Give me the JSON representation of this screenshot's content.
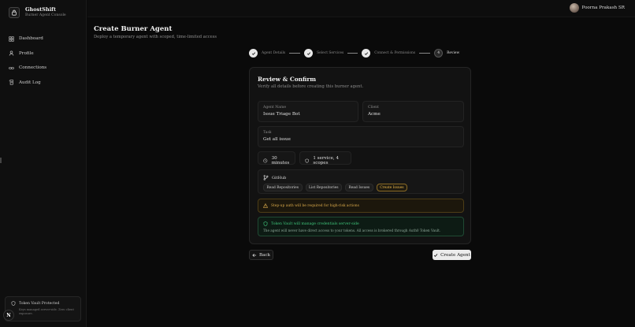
{
  "brand": {
    "name": "GhostShift",
    "subtitle": "Burner Agent Console"
  },
  "sidebar": {
    "items": [
      {
        "label": "Dashboard",
        "icon": "grid-icon"
      },
      {
        "label": "Profile",
        "icon": "user-icon"
      },
      {
        "label": "Connections",
        "icon": "link-icon"
      },
      {
        "label": "Audit Log",
        "icon": "scroll-icon"
      }
    ],
    "vault": {
      "title": "Token Vault Protected",
      "description": "Keys managed server-side. Zero client exposure."
    },
    "badge": "N"
  },
  "header": {
    "user_name": "Poorna Prakash SR"
  },
  "page": {
    "title": "Create Burner Agent",
    "subtitle": "Deploy a temporary agent with scoped, time-limited access"
  },
  "steps": [
    {
      "label": "Agent Details",
      "state": "done"
    },
    {
      "label": "Select Services",
      "state": "done"
    },
    {
      "label": "Connect & Permissions",
      "state": "done"
    },
    {
      "label": "Review",
      "state": "current",
      "number": "4"
    }
  ],
  "review": {
    "title": "Review & Confirm",
    "subtitle": "Verify all details before creating this burner agent.",
    "agent_name_label": "Agent Name",
    "agent_name": "Issue Triage Bot",
    "client_label": "Client",
    "client": "Acme",
    "task_label": "Task",
    "task": "Get all issue",
    "duration": "30 minutes",
    "scope_summary": "1 service, 4 scopes",
    "service": {
      "name": "GitHub",
      "scopes": [
        {
          "label": "Read Repositories",
          "high_risk": false
        },
        {
          "label": "List Repositories",
          "high_risk": false
        },
        {
          "label": "Read Issues",
          "high_risk": false
        },
        {
          "label": "Create Issues",
          "high_risk": true
        }
      ]
    },
    "warning": "Step-up auth will be required for high-risk actions",
    "vault_title": "Token Vault will manage credentials server-side",
    "vault_desc": "The agent will never have direct access to your tokens. All access is brokered through Auth0 Token Vault."
  },
  "actions": {
    "back": "Back",
    "create": "Create Agent"
  },
  "colors": {
    "accent": "#ececec",
    "warning": "#d9a94a",
    "success": "#3fc47a",
    "background": "#0a0a0a"
  }
}
